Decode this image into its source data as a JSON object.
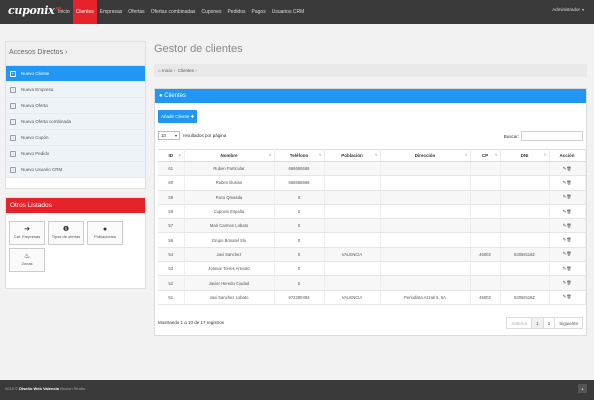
{
  "header": {
    "logo": "cuponix",
    "logo_ext": ".es",
    "nav": [
      "Inicio",
      "Clientes",
      "Empresas",
      "Ofertas",
      "Ofertas combinadas",
      "Cupones",
      "Pedidos",
      "Pagos",
      "Usuarios CRM"
    ],
    "active_index": 1,
    "user": "Administrador",
    "user_caret": "▾"
  },
  "sidebar": {
    "title": "Accesos Directos ›",
    "items": [
      {
        "label": "Nuevo Cliente",
        "icon": "user-icon",
        "glyph": "▪"
      },
      {
        "label": "Nueva Empresa",
        "icon": "building-icon",
        "glyph": "▫"
      },
      {
        "label": "Nueva Oferta",
        "icon": "tag-icon",
        "glyph": "◦"
      },
      {
        "label": "Nueva Oferta combinada",
        "icon": "tags-icon",
        "glyph": "◦"
      },
      {
        "label": "Nuevo Cupón",
        "icon": "ticket-icon",
        "glyph": "▫"
      },
      {
        "label": "Nuevo Pedido",
        "icon": "cart-icon",
        "glyph": "▫"
      },
      {
        "label": "Nuevo Usuario CRM",
        "icon": "user-plus-icon",
        "glyph": "▫"
      }
    ]
  },
  "otros": {
    "title": "Otros Listados",
    "tiles": [
      {
        "label": "Cat. Empresas",
        "icon": "arrow-right-icon",
        "glyph": "➔"
      },
      {
        "label": "Tipos de ofertas",
        "icon": "info-icon",
        "glyph": "❶"
      },
      {
        "label": "Poblaciones",
        "icon": "globe-icon",
        "glyph": "●"
      },
      {
        "label": "Zonas",
        "icon": "fire-icon",
        "glyph": "♨"
      }
    ]
  },
  "main": {
    "title": "Gestor de clientes",
    "breadcrumb_home_icon": "⌂",
    "breadcrumb": [
      "Inicio ›",
      "Clientes ›"
    ],
    "panel_title": "Clientes",
    "panel_icon": "●",
    "add_button": "Añadir Cliente",
    "add_button_icon": "✚",
    "page_length": "10",
    "page_length_label": "resultados por página",
    "search_label": "Buscar:",
    "search_value": "",
    "columns": [
      "ID",
      "Nombre",
      "Teléfono",
      "Población",
      "Dirección",
      "CP",
      "DNI",
      "Acción"
    ],
    "sort_glyph": "▲",
    "action_glyph": "✎🗑",
    "rows": [
      {
        "id": "61",
        "nombre": "Ruben Particular",
        "telefono": "666666666",
        "poblacion": "",
        "direccion": "",
        "cp": "",
        "dni": ""
      },
      {
        "id": "60",
        "nombre": "Ruben Illusion",
        "telefono": "666666666",
        "poblacion": "",
        "direccion": "",
        "cp": "",
        "dni": ""
      },
      {
        "id": "59",
        "nombre": "Paco Qmasda",
        "telefono": "0",
        "poblacion": "",
        "direccion": "",
        "cp": "",
        "dni": ""
      },
      {
        "id": "58",
        "nombre": "Cuponix España",
        "telefono": "0",
        "poblacion": "",
        "direccion": "",
        "cp": "",
        "dni": ""
      },
      {
        "id": "57",
        "nombre": "Mari Carmen Lobato",
        "telefono": "0",
        "poblacion": "",
        "direccion": "",
        "cp": "",
        "dni": ""
      },
      {
        "id": "56",
        "nombre": "Grupo Bonatel Slu",
        "telefono": "0",
        "poblacion": "",
        "direccion": "",
        "cp": "",
        "dni": ""
      },
      {
        "id": "54",
        "nombre": "Javi Sanchez",
        "telefono": "0",
        "poblacion": "VALENCIA",
        "direccion": "",
        "cp": "46002",
        "dni": "53058116Z"
      },
      {
        "id": "53",
        "nombre": "Jotovar Torres Arevalo",
        "telefono": "0",
        "poblacion": "",
        "direccion": "",
        "cp": "",
        "dni": ""
      },
      {
        "id": "52",
        "nombre": "Javier Heredo Ciudad",
        "telefono": "0",
        "poblacion": "",
        "direccion": "",
        "cp": "",
        "dni": ""
      },
      {
        "id": "51",
        "nombre": "Javi Sanchez Lobato",
        "telefono": "672280493",
        "poblacion": "VALENCIA",
        "direccion": "Periodista Azzati 5, 5A",
        "cp": "46002",
        "dni": "53058116Z"
      }
    ],
    "info": "Mostrando 1 a 10 de 17 registros",
    "pagination": [
      "Anterior",
      "1",
      "2",
      "Siguiente"
    ]
  },
  "footer": {
    "prefix": "2015 © ",
    "brand": "Diseño Web Valencia",
    "suffix": " Illusion Studio.",
    "totop_glyph": "▴"
  }
}
